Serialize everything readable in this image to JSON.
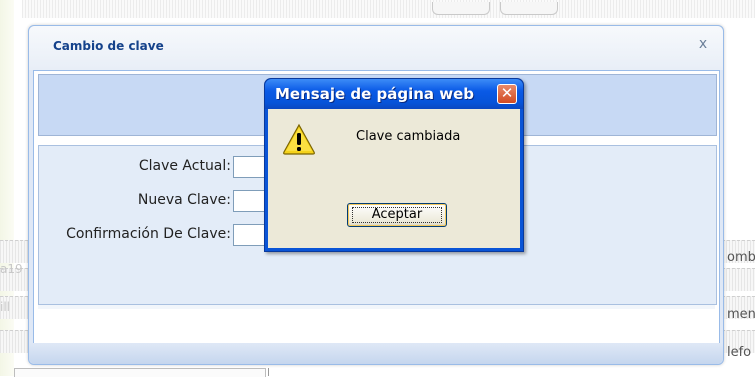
{
  "background": {
    "right_texts": [
      "ombr",
      "men",
      "lefo"
    ],
    "left_texts": [
      "a19",
      "ill"
    ]
  },
  "window": {
    "title": "Cambio de clave",
    "close_glyph": "x",
    "fields": [
      {
        "label": "Clave Actual:",
        "value": ""
      },
      {
        "label": "Nueva Clave:",
        "value": ""
      },
      {
        "label": "Confirmación De Clave:",
        "value": ""
      }
    ]
  },
  "dialog": {
    "title": "Mensaje de página web",
    "close_glyph": "✕",
    "icon": "warning-icon",
    "message": "Clave cambiada",
    "ok_label": "Aceptar"
  },
  "colors": {
    "dialog_titlebar": "#0653d8",
    "window_title": "#15428b",
    "dialog_close": "#d24b22"
  }
}
